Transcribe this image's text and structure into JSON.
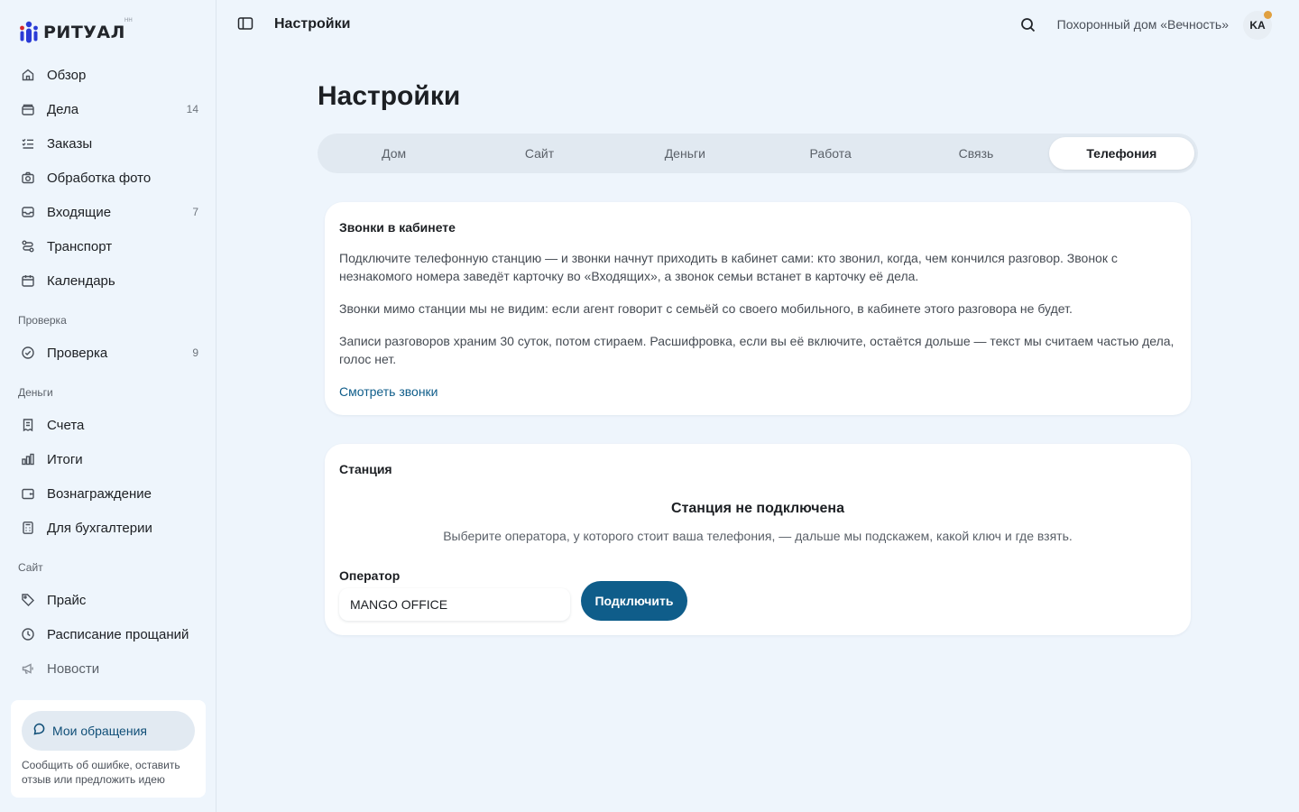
{
  "brand": {
    "name": "РИТУАЛ",
    "tm": "HH"
  },
  "sidebar": {
    "items": [
      {
        "label": "Обзор",
        "count": ""
      },
      {
        "label": "Дела",
        "count": "14"
      },
      {
        "label": "Заказы",
        "count": ""
      },
      {
        "label": "Обработка фото",
        "count": ""
      },
      {
        "label": "Входящие",
        "count": "7"
      },
      {
        "label": "Транспорт",
        "count": ""
      },
      {
        "label": "Календарь",
        "count": ""
      }
    ],
    "sections": [
      {
        "title": "Проверка",
        "items": [
          {
            "label": "Проверка",
            "count": "9"
          }
        ]
      },
      {
        "title": "Деньги",
        "items": [
          {
            "label": "Счета"
          },
          {
            "label": "Итоги"
          },
          {
            "label": "Вознаграждение"
          },
          {
            "label": "Для бухгалтерии"
          }
        ]
      },
      {
        "title": "Сайт",
        "items": [
          {
            "label": "Прайс"
          },
          {
            "label": "Расписание прощаний"
          },
          {
            "label": "Новости"
          }
        ]
      }
    ],
    "help": {
      "button_label": "Мои обращения",
      "text": "Сообщить об ошибке, оставить отзыв или предложить идею"
    }
  },
  "topbar": {
    "title": "Настройки",
    "org_name": "Похоронный дом «Вечность»",
    "avatar_initials": "KA"
  },
  "main": {
    "title": "Настройки",
    "tabs": [
      "Дом",
      "Сайт",
      "Деньги",
      "Работа",
      "Связь",
      "Телефония"
    ],
    "active_tab": "Телефония",
    "calls_card": {
      "title": "Звонки в кабинете",
      "p1": "Подключите телефонную станцию — и звонки начнут приходить в кабинет сами: кто звонил, когда, чем кончился разговор. Звонок с незнакомого номера заведёт карточку во «Входящих», а звонок семьи встанет в карточку её дела.",
      "p2": "Звонки мимо станции мы не видим: если агент говорит с семьёй со своего мобильного, в кабинете этого разговора не будет.",
      "p3": "Записи разговоров храним 30 суток, потом стираем. Расшифровка, если вы её включите, остаётся дольше — текст мы считаем частью дела, голос нет.",
      "link": "Смотреть звонки"
    },
    "station_card": {
      "title": "Станция",
      "status_heading": "Станция не подключена",
      "status_text": "Выберите оператора, у которого стоит ваша телефония, — дальше мы подскажем, какой ключ и где взять.",
      "operator_label": "Оператор",
      "operator_value": "MANGO OFFICE",
      "connect_button": "Подключить"
    }
  },
  "colors": {
    "accent": "#0f5d8a",
    "background": "#eef5fc",
    "notification_dot": "#e0a040"
  }
}
